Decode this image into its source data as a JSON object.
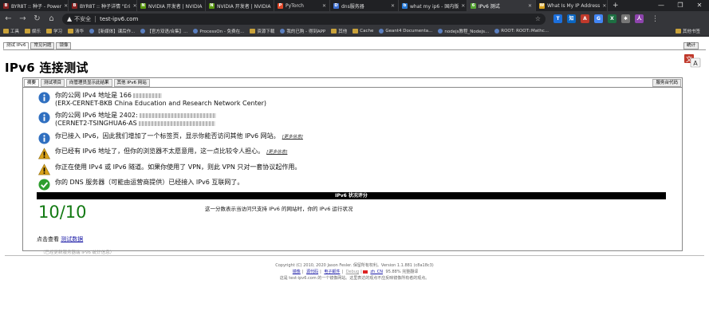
{
  "browser": {
    "tabs": [
      {
        "title": "BYR8T :: 种子 - Power",
        "fav_color": "#8a2222",
        "fav_glyph": "B"
      },
      {
        "title": "BYR8T :: 种子详情 \"Eri",
        "fav_color": "#8a2222",
        "fav_glyph": "B"
      },
      {
        "title": "NVIDIA 开发者 | NVIDIA",
        "fav_color": "#5b9a10",
        "fav_glyph": "N"
      },
      {
        "title": "NVIDIA 开发者 | NVIDIA",
        "fav_color": "#5b9a10",
        "fav_glyph": "N"
      },
      {
        "title": "PyTorch",
        "fav_color": "#e0492a",
        "fav_glyph": "P"
      },
      {
        "title": "dns服务器",
        "fav_color": "#3d6fd1",
        "fav_glyph": "D"
      },
      {
        "title": "what my ip6 - 国内版",
        "fav_color": "#2a7bd6",
        "fav_glyph": "b"
      },
      {
        "title": "IPv6 测试",
        "fav_color": "#58a636",
        "fav_glyph": "6",
        "active": true
      },
      {
        "title": "What Is My IP Address",
        "fav_color": "#d9a21b",
        "fav_glyph": "W"
      }
    ],
    "new_tab_label": "+",
    "window_controls": [
      "—",
      "❐",
      "✕"
    ],
    "nav": {
      "back": "←",
      "forward": "→",
      "reload": "↻",
      "home": "⌂"
    },
    "url": {
      "insecure_label": "不安全",
      "address": "test-ipv6.com"
    },
    "extensions": [
      {
        "name": "ext-tencent",
        "color": "#1c6fdc",
        "glyph": "T"
      },
      {
        "name": "ext-zhihu",
        "color": "#0a66c2",
        "glyph": "知"
      },
      {
        "name": "ext-adblock",
        "color": "#c0392b",
        "glyph": "A"
      },
      {
        "name": "ext-translate",
        "color": "#4285f4",
        "glyph": "G"
      },
      {
        "name": "ext-excel",
        "color": "#1d6f42",
        "glyph": "X"
      },
      {
        "name": "ext-puzzle",
        "color": "#777777",
        "glyph": "✱"
      },
      {
        "name": "ext-profile",
        "color": "#8e44ad",
        "glyph": "人"
      }
    ],
    "bookmarks": [
      {
        "label": "工具",
        "type": "folder"
      },
      {
        "label": "娱乐",
        "type": "folder"
      },
      {
        "label": "学习",
        "type": "folder"
      },
      {
        "label": "清华",
        "type": "folder"
      },
      {
        "label": "【新媒体】课后作...",
        "type": "site"
      },
      {
        "label": "【官方双语/合集】...",
        "type": "site"
      },
      {
        "label": "ProcessOn - 免费在...",
        "type": "site"
      },
      {
        "label": "资源下载",
        "type": "folder"
      },
      {
        "label": "我的已购 - 得到APP",
        "type": "site"
      },
      {
        "label": "其他",
        "type": "folder"
      },
      {
        "label": "Cache",
        "type": "folder"
      },
      {
        "label": "Geant4 Documenta...",
        "type": "site"
      },
      {
        "label": "nodejs教程_Nodejs...",
        "type": "site"
      },
      {
        "label": "ROOT: ROOT::Mathc...",
        "type": "site"
      }
    ],
    "other_bookmarks": "其他书签"
  },
  "page": {
    "top_tabs": [
      "测试 IPv6",
      "常见问题",
      "镜像"
    ],
    "stats_label": "统计",
    "title": "IPv6 连接测试",
    "sub_tabs": [
      "摘要",
      "测试项目",
      "向管理员显示此结果",
      "其他 IPv6 网站"
    ],
    "sub_tab_right": "服务台代码",
    "results": [
      {
        "icon": "info",
        "line1": "你的公网 IPv4 地址是 166",
        "line2": "(ERX-CERNET-BKB China Education and Research Network Center)"
      },
      {
        "icon": "info",
        "line1": "你的公网 IPv6 地址是 2402:",
        "line2": "(CERNET2-TSINGHUA6-AS"
      },
      {
        "icon": "info",
        "line1": "你已接入 IPv6，因此我们增加了一个标签页，显示你能否访问其他 IPv6 网站。",
        "more": "[更多信息]"
      },
      {
        "icon": "warning",
        "line1": "你已经有 IPv6 地址了，但你的浏览器不太愿意用，这一点比较令人担心。",
        "more": "[更多信息]"
      },
      {
        "icon": "warning",
        "line1": "你正在使用 IPv4 或 IPv6 隧道。如果你使用了 VPN，则此 VPN 只对一套协议起作用。"
      },
      {
        "icon": "ok",
        "line1": "你的 DNS 服务器（可能由运营商提供）已经接入 IPv6 互联网了。"
      }
    ],
    "score_header": "IPv6 状况评分",
    "score": "10/10",
    "score_desc": "这一分数表示当访问只支持 IPv6 的网站时，你的 IPv6 运行状况",
    "see_data_prefix": "点击查看",
    "see_data_link": "测试数据",
    "stats_note": "（已经更新服务器端 IPv6 统计信息）",
    "footer": {
      "copyright": "Copyright (C) 2010, 2020 Jason Fesler. 保留所有权利。Version 1.1.881 (c8a18c3)",
      "links": [
        "镜像",
        "源代码",
        "电子邮件",
        "Debug",
        "zh_CN",
        "95.88% 完整翻译"
      ],
      "attribution": "这是 test-ipv6.com 的一个镜像网站。这里表达的观点不应反映镜像所有者的观点。"
    }
  },
  "colors": {
    "info_blue": "#2f6fc0",
    "warning_amber": "#d9a21b",
    "ok_green": "#2e9e2e",
    "score_green": "#137a13"
  }
}
